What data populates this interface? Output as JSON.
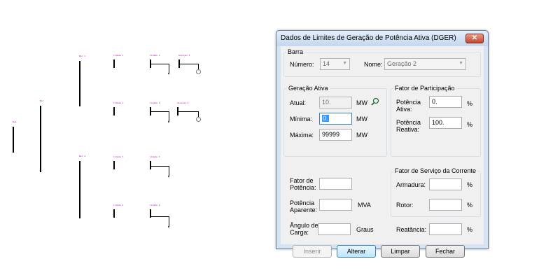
{
  "diagram": {
    "bus_labels": [
      "Bus",
      "Bar",
      "Bar 1",
      "Bar 4",
      "Cidade 1",
      "Cidade 2",
      "Cidade 3",
      "Cidade 4",
      "Cidade 1",
      "Cidade 2",
      "Cidade 3",
      "Cidade 4",
      "Geração 1",
      "Geração 2"
    ],
    "generator_icon": "generator-circle-icon",
    "load_icon": "load-arrow-icon"
  },
  "dialog": {
    "title": "Dados de Limites de Geração de Potência Ativa (DGER)",
    "close_icon": "close-icon",
    "barra": {
      "legend": "Barra",
      "numero_label": "Número:",
      "numero_value": "14",
      "nome_label": "Nome:",
      "nome_value": "Geração 2"
    },
    "geracao_ativa": {
      "legend": "Geração Ativa",
      "atual_label": "Atual:",
      "atual_value": "10.",
      "atual_unit": "MW",
      "search_icon": "search-icon",
      "minima_label": "Mínima:",
      "minima_value": "0.",
      "minima_unit": "MW",
      "maxima_label": "Máxima:",
      "maxima_value": "99999",
      "maxima_unit": "MW"
    },
    "fator_participacao": {
      "legend": "Fator de Participação",
      "potencia_ativa_label": "Potência Ativa:",
      "potencia_ativa_value": "0.",
      "potencia_ativa_unit": "%",
      "potencia_reativa_label": "Potência Reativa:",
      "potencia_reativa_value": "100.",
      "potencia_reativa_unit": "%"
    },
    "misc": {
      "fator_potencia_label": "Fator de Potência:",
      "fator_potencia_value": "",
      "potencia_aparente_label": "Potência Aparente:",
      "potencia_aparente_value": "",
      "potencia_aparente_unit": "MVA",
      "angulo_carga_label": "Ângulo de Carga:",
      "angulo_carga_value": "",
      "angulo_carga_unit": "Graus"
    },
    "fator_servico": {
      "legend": "Fator de Serviço da Corrente",
      "armadura_label": "Armadura:",
      "armadura_value": "",
      "armadura_unit": "%",
      "rotor_label": "Rotor:",
      "rotor_value": "",
      "rotor_unit": "%"
    },
    "reatancia_label": "Reatância:",
    "reatancia_value": "",
    "reatancia_unit": "%",
    "buttons": {
      "inserir": "Inserir",
      "alterar": "Alterar",
      "limpar": "Limpar",
      "fechar": "Fechar"
    }
  }
}
